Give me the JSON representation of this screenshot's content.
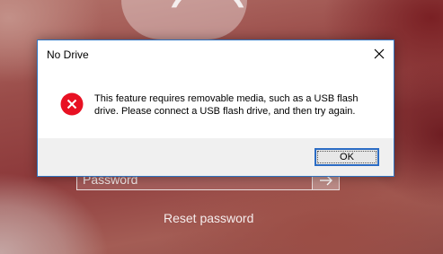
{
  "lockscreen": {
    "password_placeholder": "Password",
    "reset_link": "Reset password"
  },
  "dialog": {
    "title": "No Drive",
    "message": "This feature requires removable media, such as a USB flash drive. Please connect a USB flash drive, and then try again.",
    "ok_label": "OK",
    "icons": {
      "close": "close-icon",
      "error": "error-icon"
    }
  },
  "colors": {
    "dialog_border": "#2f74c0",
    "error_red": "#e81123",
    "footer_bg": "#f0f0f0"
  }
}
